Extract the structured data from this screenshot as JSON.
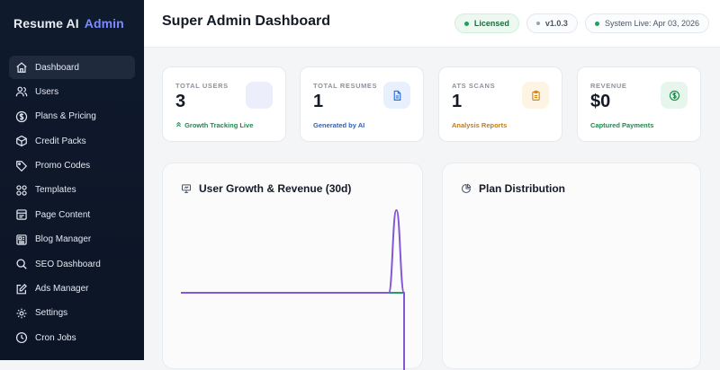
{
  "brand": {
    "name": "Resume AI",
    "suffix": "Admin"
  },
  "sidebar": {
    "items": [
      {
        "label": "Dashboard",
        "icon": "home-icon",
        "active": true
      },
      {
        "label": "Users",
        "icon": "users-icon"
      },
      {
        "label": "Plans & Pricing",
        "icon": "dollar-circle-icon"
      },
      {
        "label": "Credit Packs",
        "icon": "package-icon"
      },
      {
        "label": "Promo Codes",
        "icon": "tag-icon"
      },
      {
        "label": "Templates",
        "icon": "grid-icon"
      },
      {
        "label": "Page Content",
        "icon": "page-icon"
      },
      {
        "label": "Blog Manager",
        "icon": "blog-icon"
      },
      {
        "label": "SEO Dashboard",
        "icon": "search-icon"
      },
      {
        "label": "Ads Manager",
        "icon": "edit-icon"
      },
      {
        "label": "Settings",
        "icon": "gear-icon"
      },
      {
        "label": "Cron Jobs",
        "icon": "clock-icon"
      }
    ]
  },
  "header": {
    "title": "Super Admin Dashboard",
    "badges": {
      "licensed": "Licensed",
      "version": "v1.0.3",
      "status": "System Live: Apr 03, 2026"
    }
  },
  "stats": [
    {
      "label": "TOTAL USERS",
      "value": "3",
      "sub": "Growth Tracking Live",
      "sub_color": "#1f8a4c",
      "icon": "blank-icon",
      "icon_bg": "#eceefb"
    },
    {
      "label": "TOTAL RESUMES",
      "value": "1",
      "sub": "Generated by AI",
      "sub_color": "#2f5fb8",
      "icon": "document-icon",
      "icon_bg": "#e8f0fd"
    },
    {
      "label": "ATS SCANS",
      "value": "1",
      "sub": "Analysis Reports",
      "sub_color": "#c27c16",
      "icon": "clipboard-icon",
      "icon_bg": "#fdf4e3"
    },
    {
      "label": "REVENUE",
      "value": "$0",
      "sub": "Captured Payments",
      "sub_color": "#1f8a4c",
      "icon": "dollar-circle-icon",
      "icon_bg": "#e6f6ec"
    }
  ],
  "panels": {
    "growth": {
      "title": "User Growth & Revenue (30d)",
      "icon": "presentation-icon"
    },
    "plans": {
      "title": "Plan Distribution",
      "icon": "pie-icon"
    }
  },
  "chart_data": {
    "type": "line",
    "title": "User Growth & Revenue (30d)",
    "series": [
      {
        "color": "#1f9c74",
        "values": [
          0,
          0,
          0,
          0,
          0,
          0,
          0,
          0,
          0,
          0,
          0,
          0,
          0,
          0,
          0,
          0,
          0,
          0,
          0,
          0,
          0,
          0,
          0,
          0,
          0,
          0,
          0,
          0,
          0,
          0
        ]
      },
      {
        "color": "#8257d8",
        "values": [
          0,
          0,
          0,
          0,
          0,
          0,
          0,
          0,
          0,
          0,
          0,
          0,
          0,
          0,
          0,
          0,
          0,
          0,
          0,
          0,
          0,
          0,
          0,
          0,
          0,
          0,
          0,
          0,
          3,
          0
        ]
      }
    ]
  }
}
